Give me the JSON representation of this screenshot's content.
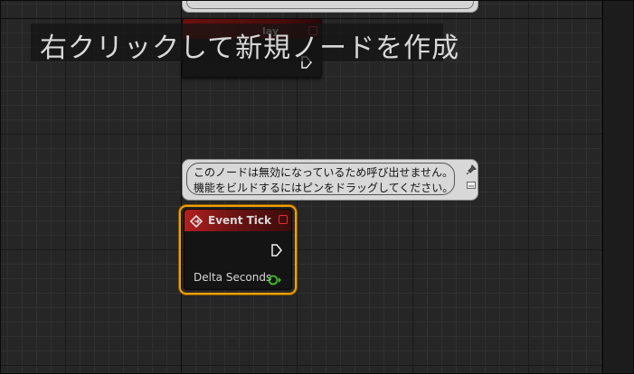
{
  "banner": {
    "text": "右クリックして新規ノードを作成"
  },
  "top_node": {
    "title_fragment": "lay"
  },
  "comment_bubble": {
    "line1": "このノードは無効になっているため呼び出せません。",
    "line2": "機能をビルドするにはピンをドラッグしてください。"
  },
  "event_node": {
    "title": "Event Tick",
    "output_pin_label": "Delta Seconds",
    "header_color": "#b32020",
    "selection_color": "#f5a000",
    "float_pin_color": "#3fbf2a"
  },
  "icons": [
    "event-diamond-icon",
    "delegate-pin-icon",
    "exec-pin-icon",
    "float-pin-icon",
    "pin-icon",
    "minimize-icon"
  ]
}
